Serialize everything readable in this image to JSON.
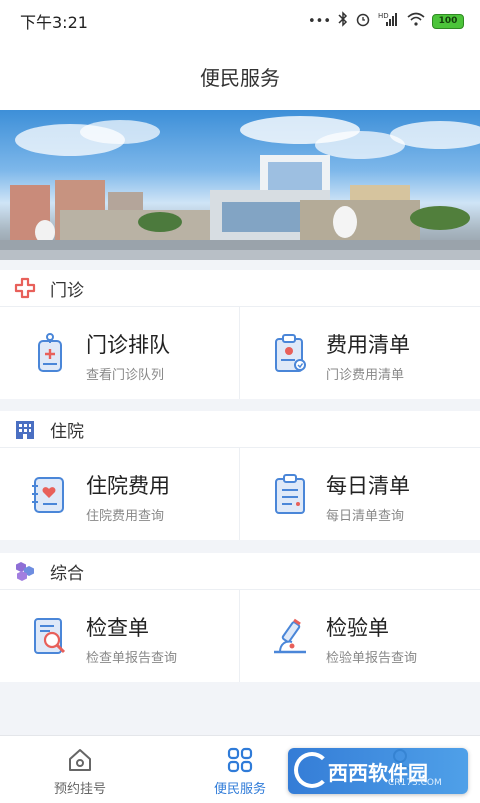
{
  "status_bar": {
    "time": "下午3:21",
    "network": "HD",
    "battery": "100"
  },
  "header": {
    "title": "便民服务"
  },
  "banner": {
    "alt_text": "",
    "image_icon": "hospital-photo"
  },
  "sections": [
    {
      "title": "门诊",
      "icon": "outpatient-cross-icon",
      "items": [
        {
          "title": "门诊排队",
          "subtitle": "查看门诊队列",
          "icon": "queue-tag-icon"
        },
        {
          "title": "费用清单",
          "subtitle": "门诊费用清单",
          "icon": "fee-list-icon"
        }
      ]
    },
    {
      "title": "住院",
      "icon": "hospital-building-icon",
      "items": [
        {
          "title": "住院费用",
          "subtitle": "住院费用查询",
          "icon": "inpatient-fee-icon"
        },
        {
          "title": "每日清单",
          "subtitle": "每日清单查询",
          "icon": "daily-list-icon"
        }
      ]
    },
    {
      "title": "综合",
      "icon": "hexagon-cluster-icon",
      "items": [
        {
          "title": "检查单",
          "subtitle": "检查单报告查询",
          "icon": "exam-report-icon"
        },
        {
          "title": "检验单",
          "subtitle": "检验单报告查询",
          "icon": "microscope-icon"
        }
      ]
    }
  ],
  "tabbar": [
    {
      "label": "预约挂号",
      "icon": "home-icon",
      "active": false
    },
    {
      "label": "便民服务",
      "icon": "grid-service-icon",
      "active": true
    },
    {
      "label": "",
      "icon": "user-icon",
      "active": false
    }
  ],
  "watermark": {
    "text": "西西软件园",
    "sub": "CR173.COM"
  },
  "colors": {
    "accent": "#2f7bd8",
    "icon_blue": "#4a86d8",
    "icon_red": "#e8605a",
    "background": "#f2f4f8"
  }
}
